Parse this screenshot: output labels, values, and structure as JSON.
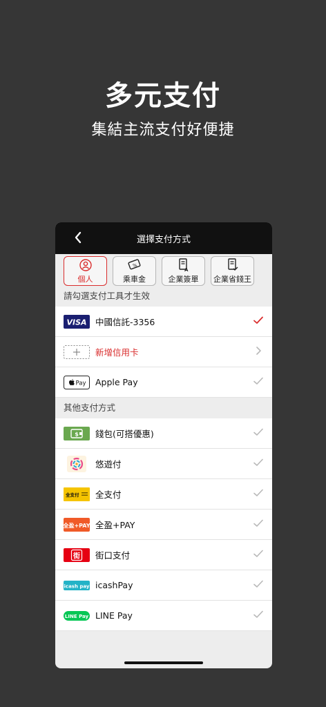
{
  "promo": {
    "title": "多元支付",
    "subtitle": "集結主流支付好便捷"
  },
  "nav": {
    "back_icon": "chevron-left-icon",
    "title": "選擇支付方式"
  },
  "tabs": [
    {
      "label": "個人",
      "icon": "person-icon",
      "active": true
    },
    {
      "label": "乘車金",
      "icon": "ticket-icon",
      "active": false
    },
    {
      "label": "企業簽單",
      "icon": "document-a-icon",
      "active": false
    },
    {
      "label": "企業省錢王",
      "icon": "document-check-icon",
      "active": false
    }
  ],
  "section_primary": "請勾選支付工具才生效",
  "primary_rows": [
    {
      "label": "中國信託-3356",
      "logo": "VISA",
      "accessory": "check-icon",
      "selected": true
    },
    {
      "label": "新增信用卡",
      "logo": "add-card-icon",
      "accessory": "chevron-right-icon",
      "selected": false
    },
    {
      "label": "Apple Pay",
      "logo": "Pay",
      "accessory": "check-icon",
      "selected": false
    }
  ],
  "section_other": "其他支付方式",
  "other_rows": [
    {
      "label": "錢包(可搭優惠)",
      "logo": "wallet-icon"
    },
    {
      "label": "悠遊付",
      "logo": "easy-wallet-icon"
    },
    {
      "label": "全支付",
      "logo": "全支付"
    },
    {
      "label": "全盈+PAY",
      "logo": "全盈+PAY"
    },
    {
      "label": "街口支付",
      "logo": "街"
    },
    {
      "label": "icashPay",
      "logo": "icash pay"
    },
    {
      "label": "LINE Pay",
      "logo": "LINE Pay"
    }
  ],
  "colors": {
    "background": "#363636",
    "accent_red": "#d92c2c",
    "nav_bg": "#111111",
    "visa_blue": "#1a1f71",
    "wallet_green": "#6aa84f",
    "full_pay_yellow": "#f5c400",
    "pxpay_orange": "#f05a28",
    "jko_red": "#e60012",
    "icash_teal": "#23b3c7",
    "line_green": "#06c755",
    "check_grey": "#b8b8b8"
  }
}
